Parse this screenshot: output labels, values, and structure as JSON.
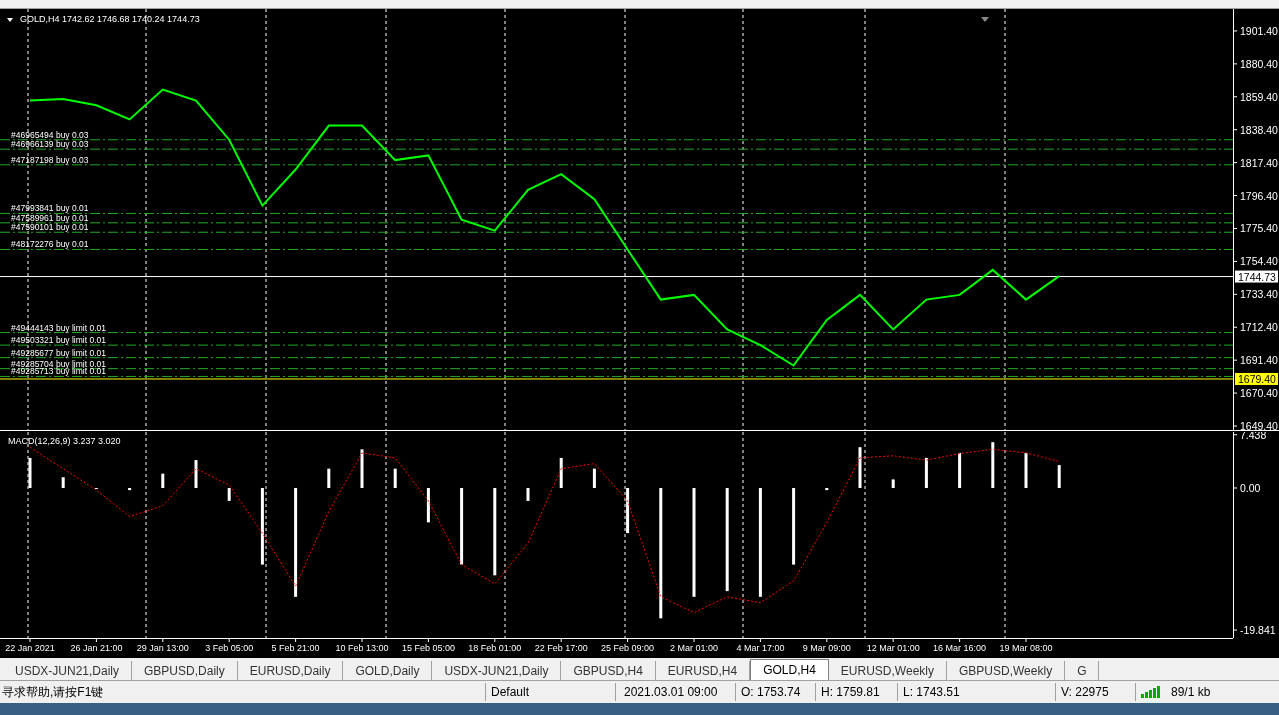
{
  "price_chart": {
    "chart_data": {
      "type": "line",
      "title": "GOLD,H4  1742.62 1746.68 1740.24 1744.73",
      "series": [
        {
          "color": "#00ff00",
          "values": [
            1857,
            1858,
            1854,
            1845,
            1864,
            1857,
            1832,
            1790,
            1813,
            1841,
            1841,
            1819,
            1822,
            1781,
            1774,
            1800,
            1810,
            1794,
            1762,
            1730,
            1733,
            1711,
            1701,
            1688,
            1717,
            1733,
            1711,
            1730,
            1733,
            1749,
            1730,
            1745
          ]
        }
      ],
      "ylim": [
        1646.85,
        1915.4
      ],
      "grid": true,
      "yticks": [
        {
          "value": 1901.4,
          "label": "1901.40"
        },
        {
          "value": 1880.4,
          "label": "1880.40"
        },
        {
          "value": 1859.4,
          "label": "1859.40"
        },
        {
          "value": 1838.4,
          "label": "1838.40"
        },
        {
          "value": 1817.4,
          "label": "1817.40"
        },
        {
          "value": 1796.4,
          "label": "1796.40"
        },
        {
          "value": 1775.4,
          "label": "1775.40"
        },
        {
          "value": 1754.4,
          "label": "1754.40"
        },
        {
          "value": 1733.4,
          "label": "1733.40"
        },
        {
          "value": 1712.4,
          "label": "1712.40"
        },
        {
          "value": 1691.4,
          "label": "1691.40"
        },
        {
          "value": 1670.4,
          "label": "1670.40"
        },
        {
          "value": 1649.4,
          "label": "1649.40"
        }
      ],
      "ref_lines": [
        {
          "axis": "y",
          "value": 1832,
          "label": "#46965494 buy 0.03",
          "color": "#22aa22",
          "line_style": "dashdot"
        },
        {
          "axis": "y",
          "value": 1826,
          "label": "#46966139 buy 0.03",
          "color": "#22aa22",
          "line_style": "dashdot"
        },
        {
          "axis": "y",
          "value": 1816,
          "label": "#47187198 buy 0.03",
          "color": "#22aa22",
          "line_style": "dashdot"
        },
        {
          "axis": "y",
          "value": 1785,
          "label": "#47993841 buy 0.01",
          "color": "#22aa22",
          "line_style": "dashdot"
        },
        {
          "axis": "y",
          "value": 1779,
          "label": "#47589961 buy 0.01",
          "color": "#22aa22",
          "line_style": "dashdot"
        },
        {
          "axis": "y",
          "value": 1773,
          "label": "#47590101 buy 0.01",
          "color": "#22aa22",
          "line_style": "dashdot"
        },
        {
          "axis": "y",
          "value": 1762,
          "label": "#48172276 buy 0.01",
          "color": "#22aa22",
          "line_style": "dashdot"
        },
        {
          "axis": "y",
          "value": 1709,
          "label": "#49444143 buy limit 0.01",
          "color": "#22aa22",
          "line_style": "dashdot"
        },
        {
          "axis": "y",
          "value": 1701,
          "label": "#49503321 buy limit 0.01",
          "color": "#22aa22",
          "line_style": "dashdot"
        },
        {
          "axis": "y",
          "value": 1693,
          "label": "#49285677 buy limit 0.01",
          "color": "#22aa22",
          "line_style": "dashdot"
        },
        {
          "axis": "y",
          "value": 1686,
          "label": "#49285704 buy limit 0.01",
          "color": "#22aa22",
          "line_style": "dashdot"
        },
        {
          "axis": "y",
          "value": 1681,
          "label": "#49285713 buy limit 0.01",
          "color": "#22aa22",
          "line_style": "dashdot"
        },
        {
          "axis": "y",
          "value": 1744.73,
          "label": "1744.73",
          "color": "#ffffff",
          "line_style": "solid"
        },
        {
          "axis": "y",
          "value": 1679.4,
          "label": "1679.40",
          "color": "#ffff00",
          "line_style": "solid"
        }
      ]
    }
  },
  "macd_chart": {
    "chart_data": {
      "type": "bar",
      "title": "MACD(12,26,9) 3.237 3.020",
      "categories": [
        "22 Jan 2021",
        null,
        "26 Jan 21:00",
        null,
        "29 Jan 13:00",
        null,
        "3 Feb 05:00",
        null,
        "5 Feb 21:00",
        null,
        "10 Feb 13:00",
        null,
        "15 Feb 05:00",
        null,
        "18 Feb 01:00",
        null,
        "22 Feb 17:00",
        null,
        "25 Feb 09:00",
        null,
        "2 Mar 01:00",
        null,
        "4 Mar 17:00",
        null,
        "9 Mar 09:00",
        null,
        "12 Mar 01:00",
        null,
        "16 Mar 16:00",
        null,
        "19 Mar 08:00",
        null
      ],
      "series": [
        {
          "color": "#ffffff",
          "values": [
            4.2,
            1.5,
            0,
            -0.3,
            2,
            3.9,
            -1.8,
            -10.7,
            -15.2,
            2.7,
            5.4,
            2.7,
            -4.8,
            -10.7,
            -12.2,
            -1.8,
            4.2,
            2.7,
            -6.3,
            -18.2,
            -15.2,
            -14.4,
            -15.2,
            -10.7,
            -0.3,
            5.7,
            1.2,
            4.2,
            4.9,
            6.4,
            4.9,
            3.2
          ]
        },
        {
          "type": "line",
          "line_style": "dashed",
          "color": "#ff0000",
          "values": [
            5.7,
            2.7,
            -0.3,
            -4,
            -2.5,
            2.7,
            0.4,
            -6.3,
            -13.7,
            -3.3,
            4.9,
            4.2,
            -1.8,
            -10.7,
            -13.4,
            -7.7,
            2.7,
            3.4,
            -1.8,
            -15.2,
            -17.4,
            -15.2,
            -16,
            -13,
            -4.8,
            4.2,
            4.5,
            3.9,
            4.8,
            5.4,
            4.9,
            3.7
          ]
        }
      ],
      "ylim": [
        -20.95,
        7.82
      ],
      "grid": true,
      "yticks": [
        {
          "value": 7.438,
          "label": "7.438"
        },
        {
          "value": 0,
          "label": "0.00"
        },
        {
          "value": -19.841,
          "label": "-19.841"
        }
      ]
    }
  },
  "tabs": [
    {
      "label": "USDX-JUN21,Daily",
      "selected": false
    },
    {
      "label": "GBPUSD,Daily",
      "selected": false
    },
    {
      "label": "EURUSD,Daily",
      "selected": false
    },
    {
      "label": "GOLD,Daily",
      "selected": false
    },
    {
      "label": "USDX-JUN21,Daily",
      "selected": false
    },
    {
      "label": "GBPUSD,H4",
      "selected": false
    },
    {
      "label": "EURUSD,H4",
      "selected": false
    },
    {
      "label": "GOLD,H4",
      "selected": true
    },
    {
      "label": "EURUSD,Weekly",
      "selected": false
    },
    {
      "label": "GBPUSD,Weekly",
      "selected": false
    },
    {
      "label": "G",
      "selected": false
    }
  ],
  "status_bar": {
    "help": "寻求帮助,请按F1键",
    "profile": "Default",
    "time": "2021.03.01 09:00",
    "open": "O: 1753.74",
    "high": "H: 1759.81",
    "low": "L: 1743.51",
    "volume": "V: 22975",
    "traffic": "89/1 kb"
  }
}
